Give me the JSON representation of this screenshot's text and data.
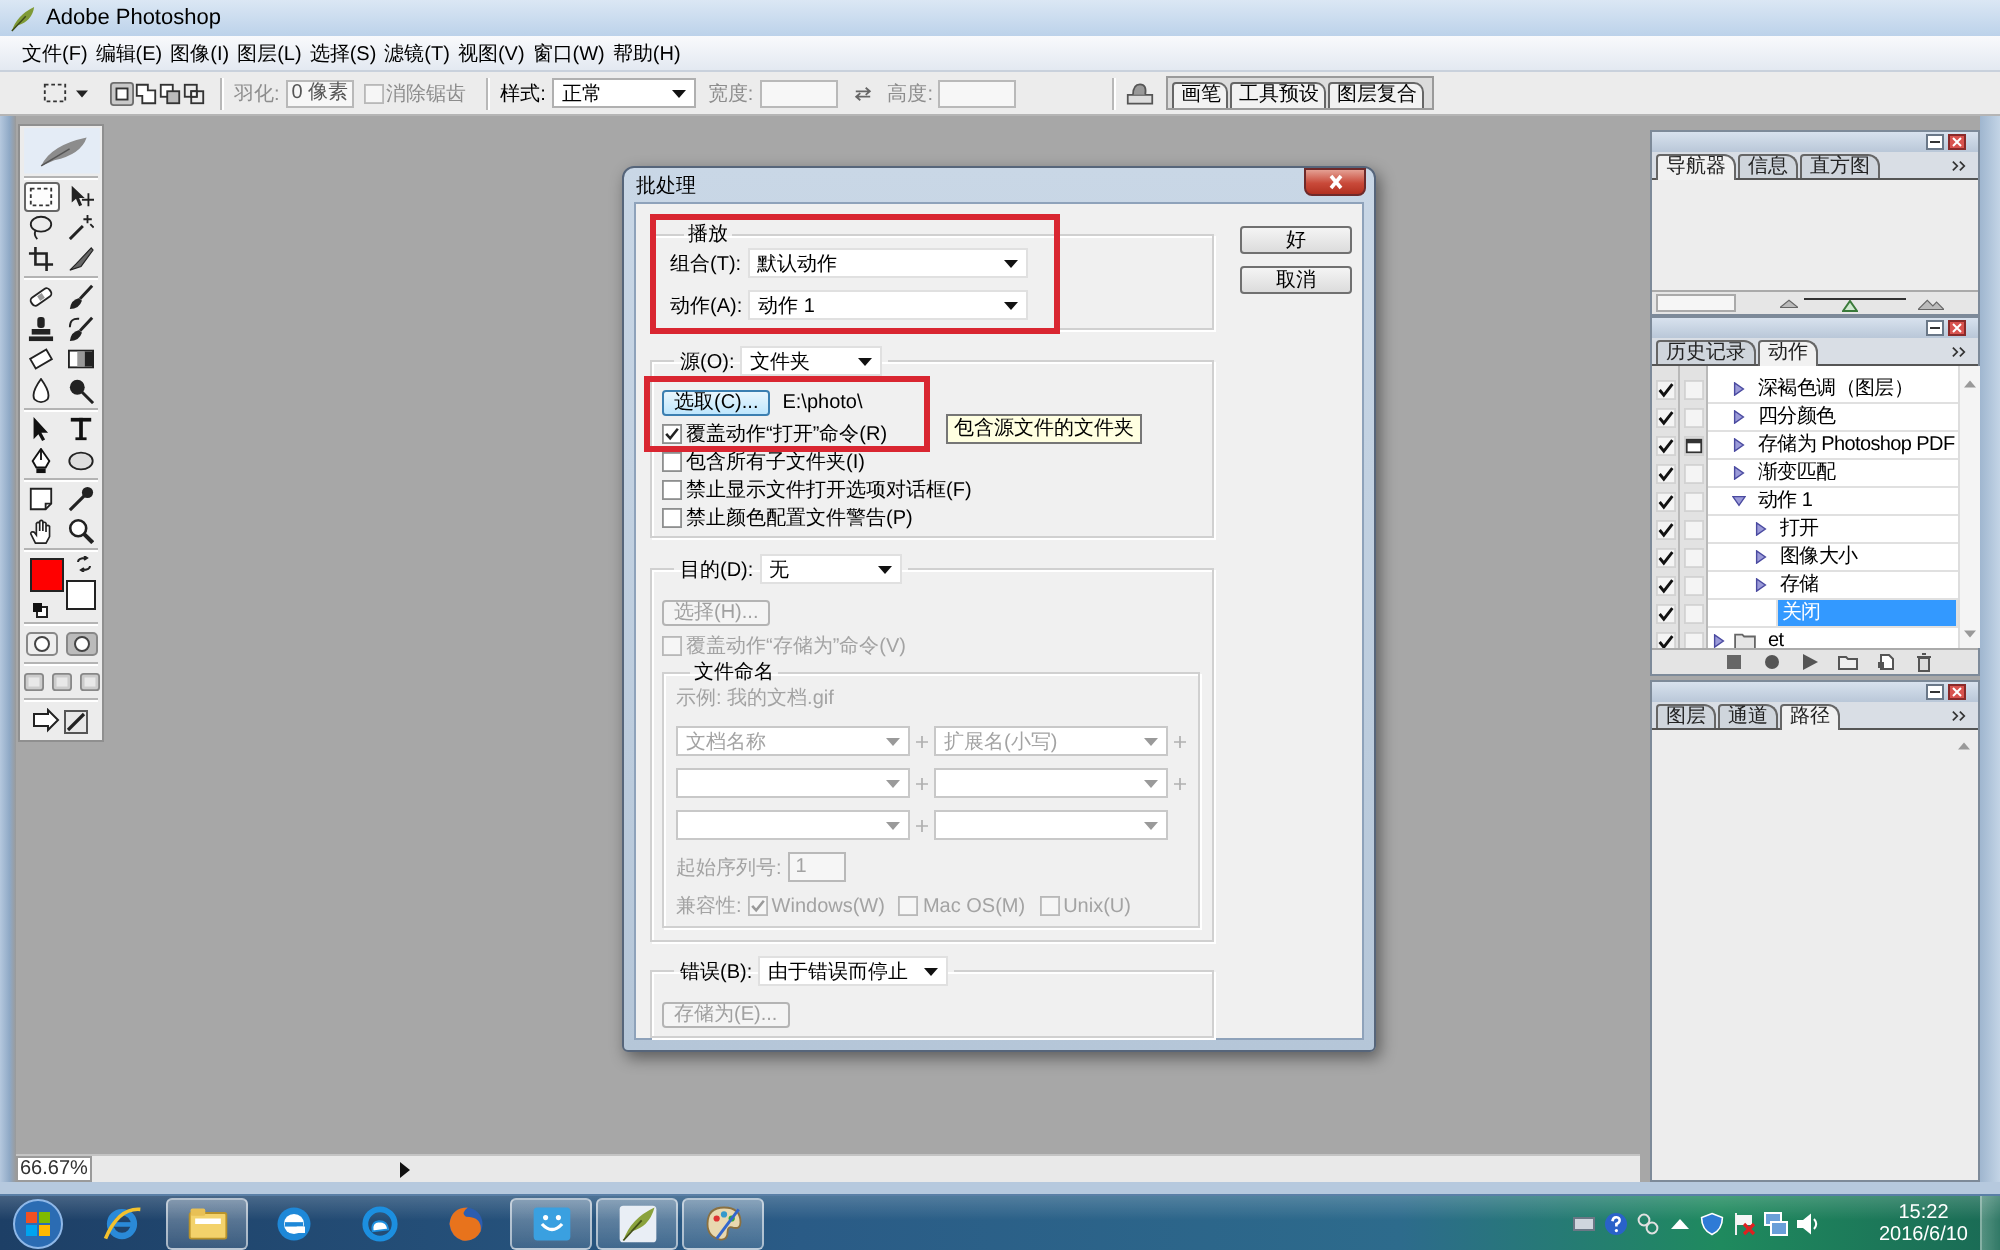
{
  "window": {
    "title": "Adobe Photoshop"
  },
  "menu": [
    "文件(F)",
    "编辑(E)",
    "图像(I)",
    "图层(L)",
    "选择(S)",
    "滤镜(T)",
    "视图(V)",
    "窗口(W)",
    "帮助(H)"
  ],
  "options_bar": {
    "tool_modes": [
      {
        "selected": true
      },
      {
        "selected": false
      },
      {
        "selected": false
      },
      {
        "selected": false
      }
    ],
    "feather_label": "羽化:",
    "feather_value": "0 像素",
    "anti_alias": {
      "label": "消除锯齿",
      "checked": false,
      "disabled": true
    },
    "style_label": "样式:",
    "style_value": "正常",
    "width": {
      "label": "宽度:",
      "disabled": true
    },
    "height": {
      "label": "高度:",
      "disabled": true
    },
    "palette_tabs": [
      "画笔",
      "工具预设",
      "图层复合"
    ]
  },
  "toolbox": {
    "tools": [
      {
        "selected": true
      },
      {
        "selected": false
      },
      {
        "selected": false
      },
      {
        "selected": false
      },
      {
        "selected": false
      },
      {
        "selected": false
      },
      {
        "selected": false
      },
      {
        "selected": false
      },
      {
        "selected": false
      },
      {
        "selected": false
      },
      {
        "selected": false
      },
      {
        "selected": false
      },
      {
        "selected": false
      },
      {
        "selected": false
      },
      {
        "selected": false
      },
      {
        "selected": false
      },
      {
        "selected": false
      },
      {
        "selected": false
      },
      {
        "selected": false
      },
      {
        "selected": false
      },
      {
        "selected": false
      },
      {
        "selected": false
      }
    ],
    "color_swatches": [
      {
        "color": "#ff0000"
      },
      {
        "color": "#ffffff"
      }
    ]
  },
  "dialog": {
    "title": "批处理",
    "play": {
      "legend": "播放",
      "fields": [
        {
          "label": "组合(T):",
          "value": "默认动作"
        },
        {
          "label": "动作(A):",
          "value": "动作 1"
        }
      ]
    },
    "buttons": [
      "好",
      "取消"
    ],
    "source": {
      "label": "源(O):",
      "value": "文件夹",
      "choose_button": "选取(C)...",
      "path": "E:\\photo\\",
      "options": [
        {
          "label": "覆盖动作“打开”命令(R)",
          "checked": true
        },
        {
          "label": "包含所有子文件夹(I)",
          "checked": false
        },
        {
          "label": "禁止显示文件打开选项对话框(F)",
          "checked": false
        },
        {
          "label": "禁止颜色配置文件警告(P)",
          "checked": false
        }
      ]
    },
    "tooltip": "包含源文件的文件夹",
    "destination": {
      "label": "目的(D):",
      "value": "无",
      "choose_button": "选择(H)...",
      "disabled": true,
      "override": {
        "label": "覆盖动作“存储为”命令(V)",
        "checked": false
      },
      "file_naming": {
        "legend": "文件命名",
        "example": "示例: 我的文档.gif",
        "rows": [
          {
            "left": "文档名称",
            "right": "扩展名(小写)"
          },
          {},
          {}
        ],
        "serial_label": "起始序列号:",
        "serial_value": "1",
        "compat_label": "兼容性:",
        "compat": [
          {
            "label": "Windows(W)",
            "checked": true
          },
          {
            "label": "Mac OS(M)",
            "checked": false
          },
          {
            "label": "Unix(U)",
            "checked": false
          }
        ]
      }
    },
    "errors": {
      "label": "错误(B):",
      "value": "由于错误而停止",
      "save_button": "存储为(E)...",
      "save_disabled": true
    }
  },
  "panels": [
    {
      "kind": "navigator",
      "tabs": [
        {
          "label": "导航器",
          "selected": true
        },
        {
          "label": "信息",
          "selected": false
        },
        {
          "label": "直方图",
          "selected": false
        }
      ],
      "zoom_slider": {
        "level": 0.45
      }
    },
    {
      "kind": "actions",
      "tabs": [
        {
          "label": "历史记录",
          "selected": false
        },
        {
          "label": "动作",
          "selected": true
        }
      ],
      "items": [
        {
          "label": "深褐色调（图层）",
          "kind": "item",
          "expanded": false,
          "checked": true,
          "dialog": false,
          "selected": false
        },
        {
          "label": "四分颜色",
          "kind": "item",
          "expanded": false,
          "checked": true,
          "dialog": false,
          "selected": false
        },
        {
          "label": "存储为 Photoshop PDF",
          "kind": "item",
          "expanded": false,
          "checked": true,
          "dialog": true,
          "selected": false
        },
        {
          "label": "渐变匹配",
          "kind": "item",
          "expanded": false,
          "checked": true,
          "dialog": false,
          "selected": false
        },
        {
          "label": "动作 1",
          "kind": "item",
          "expanded": true,
          "checked": true,
          "dialog": false,
          "selected": false,
          "children": [
            {
              "label": "打开",
              "kind": "item",
              "expanded": false,
              "checked": true,
              "dialog": false,
              "selected": false
            },
            {
              "label": "图像大小",
              "kind": "item",
              "expanded": false,
              "checked": true,
              "dialog": false,
              "selected": false
            },
            {
              "label": "存储",
              "kind": "item",
              "expanded": false,
              "checked": true,
              "dialog": false,
              "selected": false
            },
            {
              "label": "关闭",
              "kind": "leaf",
              "checked": true,
              "dialog": false,
              "selected": true
            }
          ]
        },
        {
          "label": "et",
          "kind": "set",
          "expanded": false,
          "checked": true,
          "dialog": false,
          "selected": false
        }
      ]
    },
    {
      "kind": "layers",
      "tabs": [
        {
          "label": "图层",
          "selected": false
        },
        {
          "label": "通道",
          "selected": false
        },
        {
          "label": "路径",
          "selected": true
        }
      ]
    }
  ],
  "status_bar": {
    "zoom": "66.67%"
  },
  "taskbar": {
    "apps": [
      {
        "active": false
      },
      {
        "active": true
      },
      {
        "active": false
      },
      {
        "active": false
      },
      {
        "active": false
      },
      {
        "active": true
      },
      {
        "active": true
      },
      {
        "active": true
      }
    ],
    "time": "15:22",
    "date": "2016/6/10"
  }
}
